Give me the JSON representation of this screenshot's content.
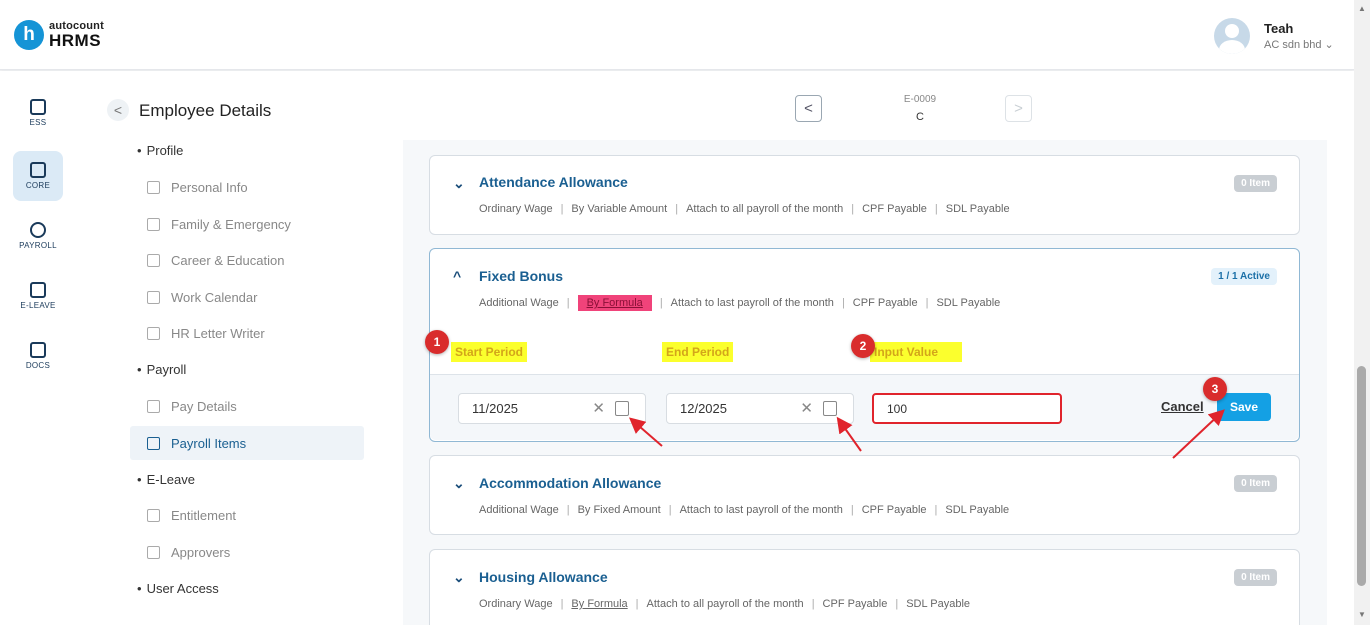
{
  "app": {
    "logo_letter": "h",
    "logo_top": "autocount",
    "logo_bottom": "HRMS"
  },
  "user": {
    "name": "Teah",
    "company": "AC sdn bhd ⌄"
  },
  "rail": [
    {
      "label": "ESS"
    },
    {
      "label": "CORE"
    },
    {
      "label": "PAYROLL"
    },
    {
      "label": "E-LEAVE"
    },
    {
      "label": "DOCS"
    }
  ],
  "page": {
    "title": "Employee Details",
    "back": "<"
  },
  "employee": {
    "id": "E-0009",
    "name": "C",
    "prev": "<",
    "next": ">"
  },
  "menu": {
    "profile": "Profile",
    "personal_info": "Personal Info",
    "family": "Family & Emergency",
    "career": "Career & Education",
    "calendar": "Work Calendar",
    "hr_letter": "HR Letter Writer",
    "payroll": "Payroll",
    "pay_details": "Pay Details",
    "payroll_items": "Payroll Items",
    "eleave": "E-Leave",
    "entitlement": "Entitlement",
    "approvers": "Approvers",
    "user_access": "User Access"
  },
  "cards": {
    "attendance": {
      "title": "Attendance Allowance",
      "meta": [
        "Ordinary Wage",
        "By Variable Amount",
        "Attach to all payroll of the month",
        "CPF Payable",
        "SDL Payable"
      ],
      "badge": "0 Item"
    },
    "fixed_bonus": {
      "title": "Fixed Bonus",
      "meta": [
        "Additional Wage",
        "By Formula",
        "Attach to last payroll of the month",
        "CPF Payable",
        "SDL Payable"
      ],
      "badge": "1 / 1 Active"
    },
    "accommodation": {
      "title": "Accommodation Allowance",
      "meta": [
        "Additional Wage",
        "By Fixed Amount",
        "Attach to last payroll of the month",
        "CPF Payable",
        "SDL Payable"
      ],
      "badge": "0 Item"
    },
    "housing": {
      "title": "Housing Allowance",
      "meta": [
        "Ordinary Wage",
        "By Formula",
        "Attach to all payroll of the month",
        "CPF Payable",
        "SDL Payable"
      ],
      "badge": "0 Item"
    }
  },
  "form": {
    "start_label": "Start Period",
    "end_label": "End Period",
    "value_label": "Input Value",
    "start_value": "11/2025",
    "end_value": "12/2025",
    "input_value": "100",
    "clear": "✕",
    "cancel": "Cancel",
    "save": "Save"
  },
  "markers": [
    "1",
    "2",
    "3"
  ],
  "icons": {
    "chevron_down": "⌄",
    "chevron_up": "^"
  },
  "colors": {
    "accent": "#1a5f91",
    "save_button": "#14a0e4",
    "highlight_yellow": "#fbff2d",
    "highlight_pink": "#f0437a",
    "annotation_red": "#d92c2c"
  }
}
